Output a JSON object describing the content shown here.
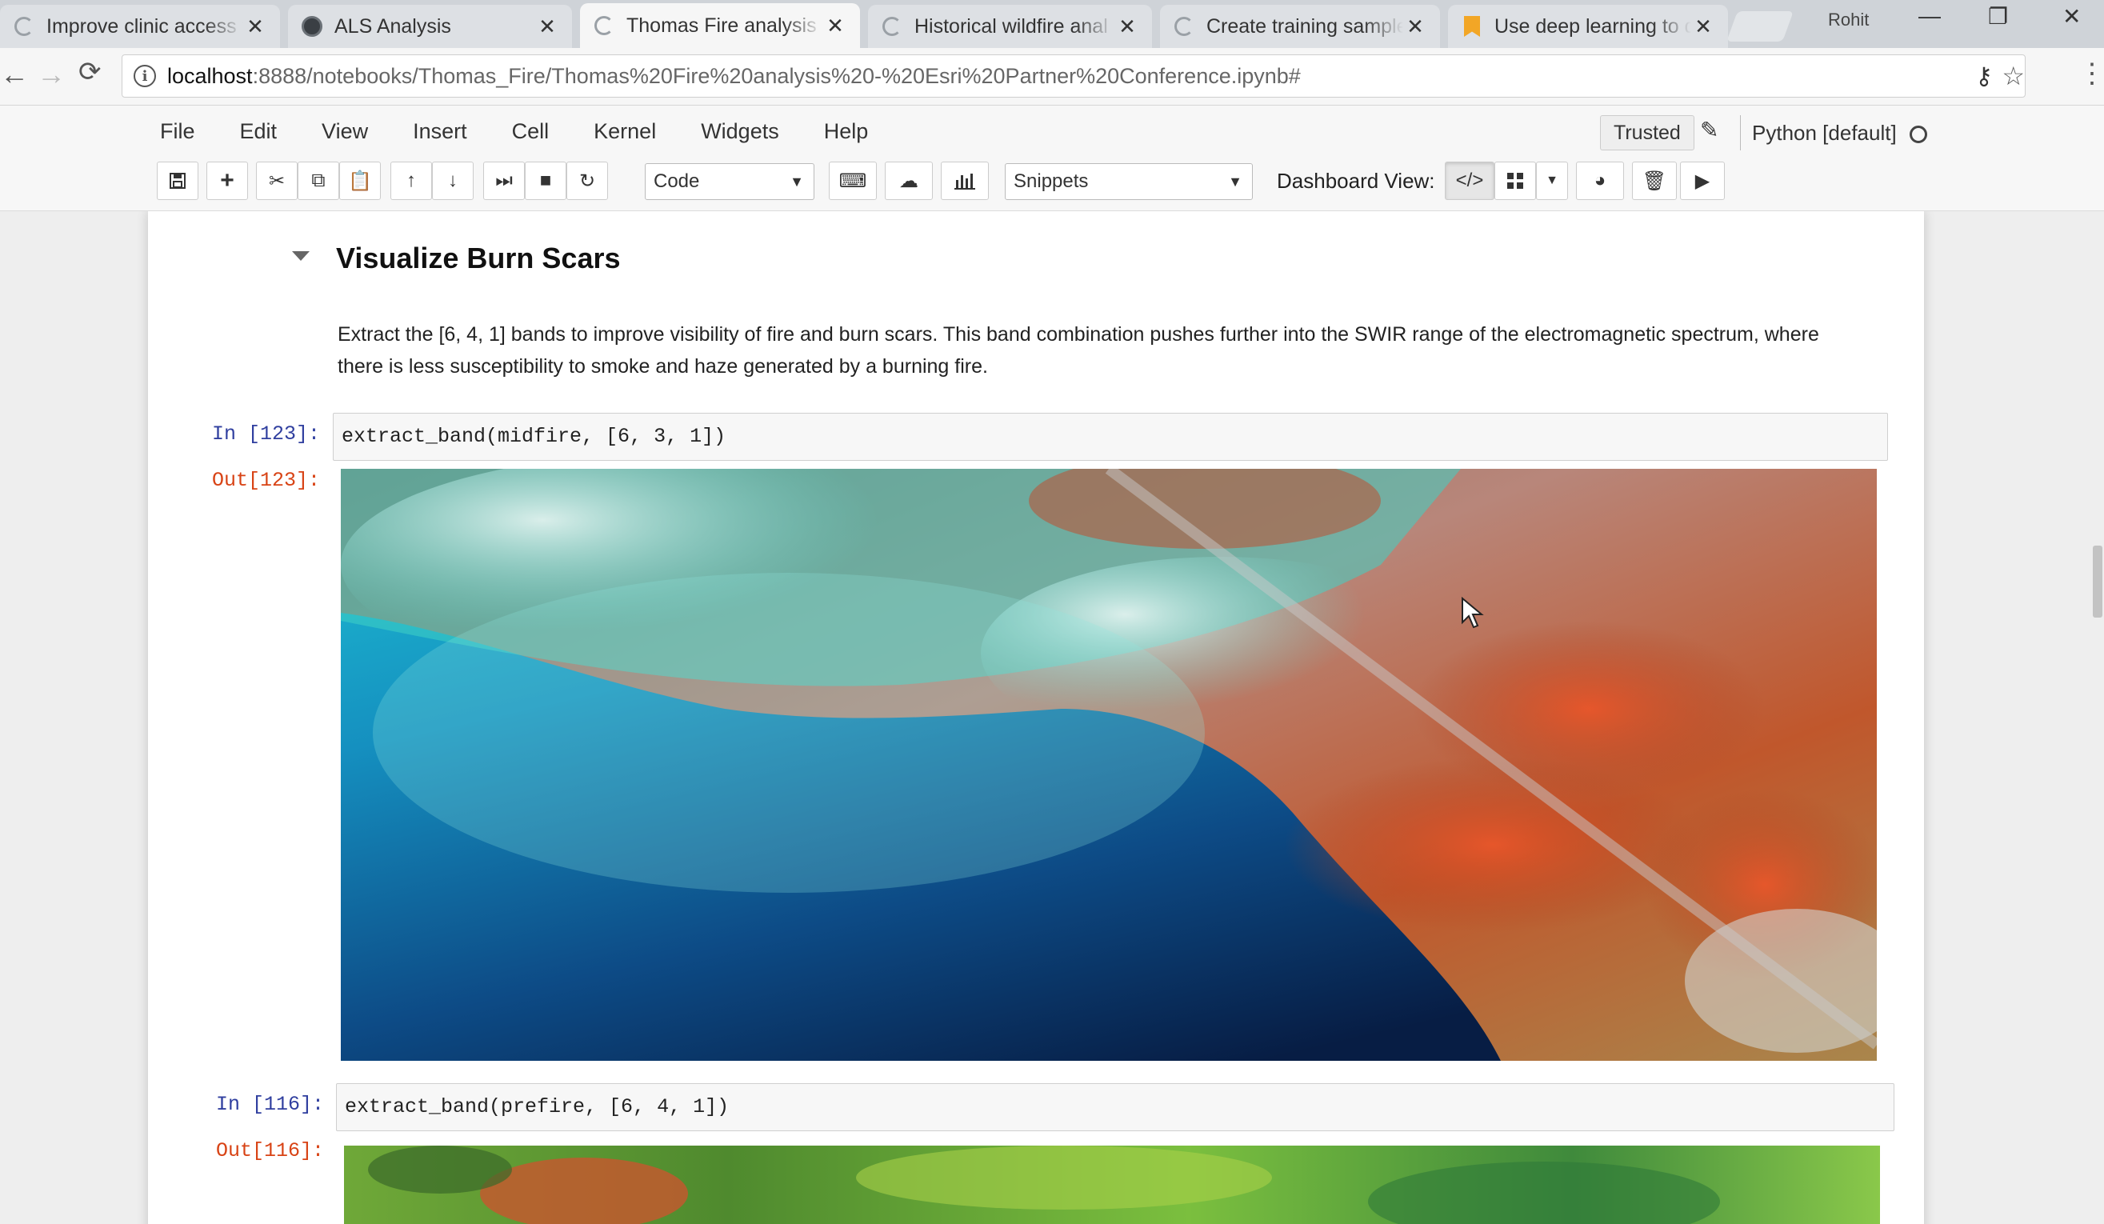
{
  "browser": {
    "tabs": [
      {
        "label": "Improve clinic access f",
        "icon": "spinner-icon"
      },
      {
        "label": "ALS Analysis",
        "icon": "globe-icon"
      },
      {
        "label": "Thomas Fire analysis - ",
        "icon": "spinner-icon",
        "active": true
      },
      {
        "label": "Historical wildfire anal",
        "icon": "spinner-icon"
      },
      {
        "label": "Create training sample",
        "icon": "spinner-icon"
      },
      {
        "label": "Use deep learning to d",
        "icon": "bookmark-icon"
      }
    ],
    "profile_name": "Rohit",
    "url_host": "localhost",
    "url_rest": ":8888/notebooks/Thomas_Fire/Thomas%20Fire%20analysis%20-%20Esri%20Partner%20Conference.ipynb#"
  },
  "jupyter": {
    "menu": [
      "File",
      "Edit",
      "View",
      "Insert",
      "Cell",
      "Kernel",
      "Widgets",
      "Help"
    ],
    "trusted_label": "Trusted",
    "kernel_name": "Python [default]",
    "cell_type": "Code",
    "snippets_label": "Snippets",
    "dashboard_label": "Dashboard View:"
  },
  "notebook": {
    "section_title": "Visualize Burn Scars",
    "paragraph": "Extract the [6, 4, 1] bands to improve visibility of fire and burn scars. This band combination pushes further into the SWIR range of the electromagnetic spectrum, where there is less susceptibility to smoke and haze generated by a burning fire.",
    "cells": [
      {
        "in_prompt": "In [123]:",
        "code": "extract_band(midfire, [6, 3, 1])",
        "out_prompt": "Out[123]:"
      },
      {
        "in_prompt": "In [116]:",
        "code": "extract_band(prefire, [6, 4, 1])",
        "out_prompt": "Out[116]:"
      }
    ]
  },
  "colors": {
    "accent_in_prompt": "#303f9f",
    "accent_out_prompt": "#d84315",
    "ocean_deep": "#0b2a55",
    "ocean_cyan": "#1fc4d4",
    "burn_orange": "#d8552a",
    "vegetation_green": "#4fa83a"
  }
}
